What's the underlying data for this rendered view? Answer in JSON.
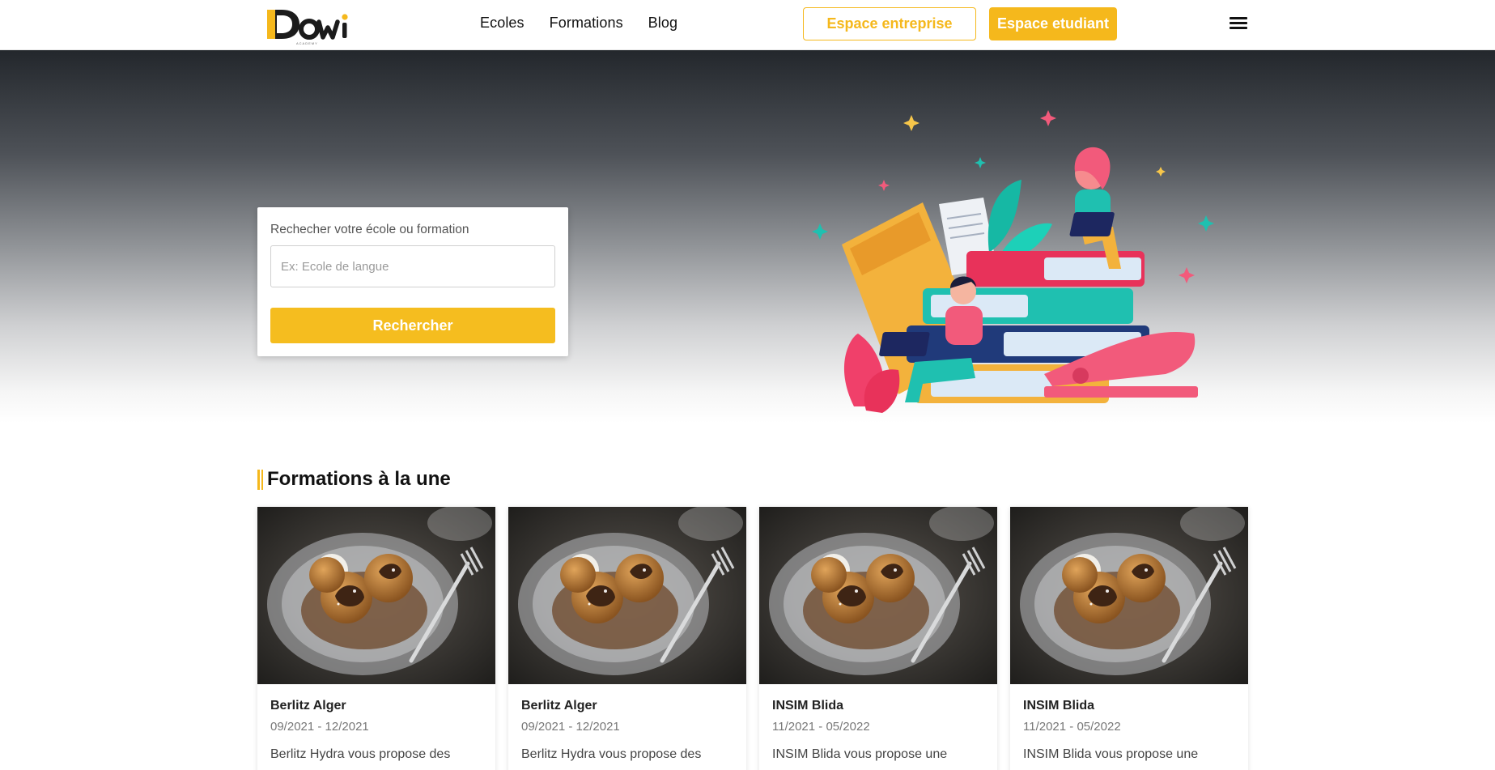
{
  "brand": {
    "logo_text": "Dowi",
    "logo_subtext": "ACADEMY",
    "accent": "#f5b81c"
  },
  "nav": {
    "links": [
      "Ecoles",
      "Formations",
      "Blog"
    ],
    "espace_entreprise": "Espace entreprise",
    "espace_etudiant": "Espace etudiant",
    "menu_icon": "hamburger-icon"
  },
  "hero": {
    "search_label": "Rechecher votre école ou formation",
    "search_placeholder": "Ex: Ecole de langue",
    "search_button": "Rechercher",
    "illustration": "students-on-books-illustration"
  },
  "section": {
    "title": "Formations à la une",
    "cards": [
      {
        "title": "Berlitz Alger",
        "date": "09/2021 - 12/2021",
        "desc": "Berlitz Hydra vous propose des cours",
        "image": "dessert-photo"
      },
      {
        "title": "Berlitz Alger",
        "date": "09/2021 - 12/2021",
        "desc": "Berlitz Hydra vous propose des cours",
        "image": "dessert-photo"
      },
      {
        "title": "INSIM Blida",
        "date": "11/2021 - 05/2022",
        "desc": "INSIM Blida vous propose une",
        "image": "dessert-photo"
      },
      {
        "title": "INSIM Blida",
        "date": "11/2021 - 05/2022",
        "desc": "INSIM Blida vous propose une",
        "image": "dessert-photo"
      }
    ]
  }
}
